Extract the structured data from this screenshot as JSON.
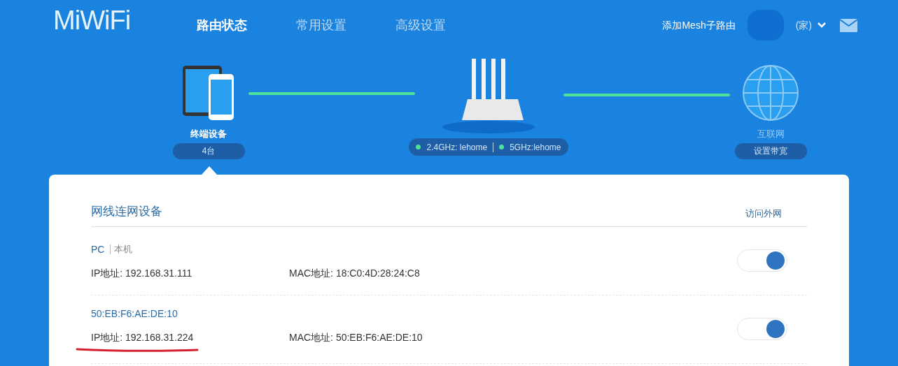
{
  "logo": "MiWiFi",
  "nav": [
    {
      "label": "路由状态",
      "selected": true
    },
    {
      "label": "常用设置",
      "selected": false
    },
    {
      "label": "高级设置",
      "selected": false
    }
  ],
  "header": {
    "mesh_link": "添加Mesh子路由",
    "router_name_suffix": "(家)"
  },
  "topology": {
    "devices": {
      "label": "终端设备",
      "count": "4台"
    },
    "wifi": [
      {
        "label": "2.4GHz: lehome",
        "active": true
      },
      {
        "label": "5GHz:lehome",
        "active": true
      }
    ],
    "internet": {
      "label": "互联网",
      "button": "设置带宽"
    }
  },
  "wired_devices": {
    "title": "网线连网设备",
    "column_header": "访问外网",
    "rows": [
      {
        "name": "PC",
        "tag": "本机",
        "ip_label": "IP地址:",
        "ip": "192.168.31.111",
        "mac_label": "MAC地址:",
        "mac": "18:C0:4D:28:24:C8",
        "on": true,
        "underlined": false
      },
      {
        "name": "50:EB:F6:AE:DE:10",
        "ip_label": "IP地址:",
        "ip": "192.168.31.224",
        "mac_label": "MAC地址:",
        "mac": "50:EB:F6:AE:DE:10",
        "on": true,
        "underlined": true
      }
    ]
  }
}
